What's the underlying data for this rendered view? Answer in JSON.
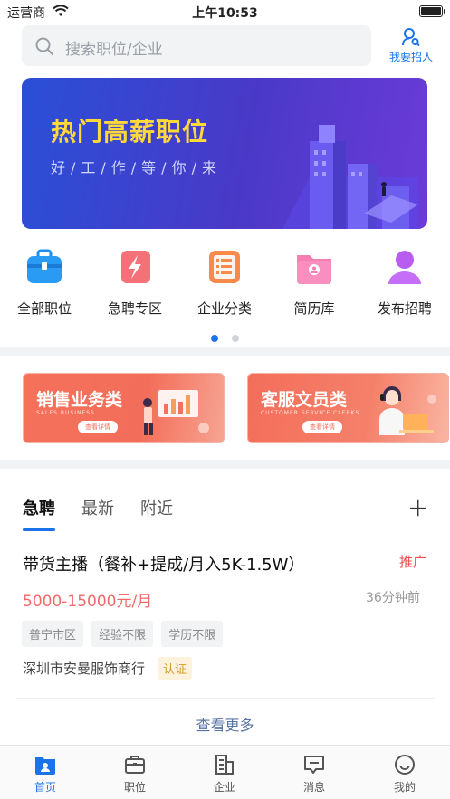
{
  "status_bar": {
    "carrier": "运营商",
    "time": "上午10:53"
  },
  "search": {
    "placeholder": "搜索职位/企业"
  },
  "header": {
    "recruit_label": "我要招人"
  },
  "banner": {
    "title": "热门高薪职位",
    "subtitle": "好/工/作/等/你/来"
  },
  "categories": [
    {
      "label": "全部职位",
      "icon": "briefcase-icon"
    },
    {
      "label": "急聘专区",
      "icon": "lightning-icon"
    },
    {
      "label": "企业分类",
      "icon": "list-icon"
    },
    {
      "label": "简历库",
      "icon": "resume-folder-icon"
    },
    {
      "label": "发布招聘",
      "icon": "person-icon"
    }
  ],
  "carousel": {
    "pages": 2,
    "active": 1
  },
  "promos": [
    {
      "title": "销售业务类",
      "subtitle": "SALES BUSINESS",
      "button": "查看详情"
    },
    {
      "title": "客服文员类",
      "subtitle": "CUSTOMER SERVICE CLERKS",
      "button": "查看详情"
    }
  ],
  "tabs": [
    "急聘",
    "最新",
    "附近"
  ],
  "add_label": "+",
  "job": {
    "title": "带货主播（餐补+提成/月入5K-1.5W）",
    "tag": "推广",
    "salary": "5000-15000元/月",
    "posted": "36分钟前",
    "chips": [
      "普宁市区",
      "经验不限",
      "学历不限"
    ],
    "company": "深圳市安曼服饰商行",
    "verified": "认证"
  },
  "more_label": "查看更多",
  "tabbar": [
    {
      "label": "首页",
      "icon": "home-folder-icon",
      "active": true
    },
    {
      "label": "职位",
      "icon": "briefcase-icon",
      "active": false
    },
    {
      "label": "企业",
      "icon": "building-icon",
      "active": false
    },
    {
      "label": "消息",
      "icon": "message-icon",
      "active": false
    },
    {
      "label": "我的",
      "icon": "smiley-icon",
      "active": false
    }
  ],
  "colors": {
    "accent": "#1a73e8",
    "banner_title": "#ffd83a",
    "salary": "#f06a6a",
    "promo": "#f36e5a"
  }
}
